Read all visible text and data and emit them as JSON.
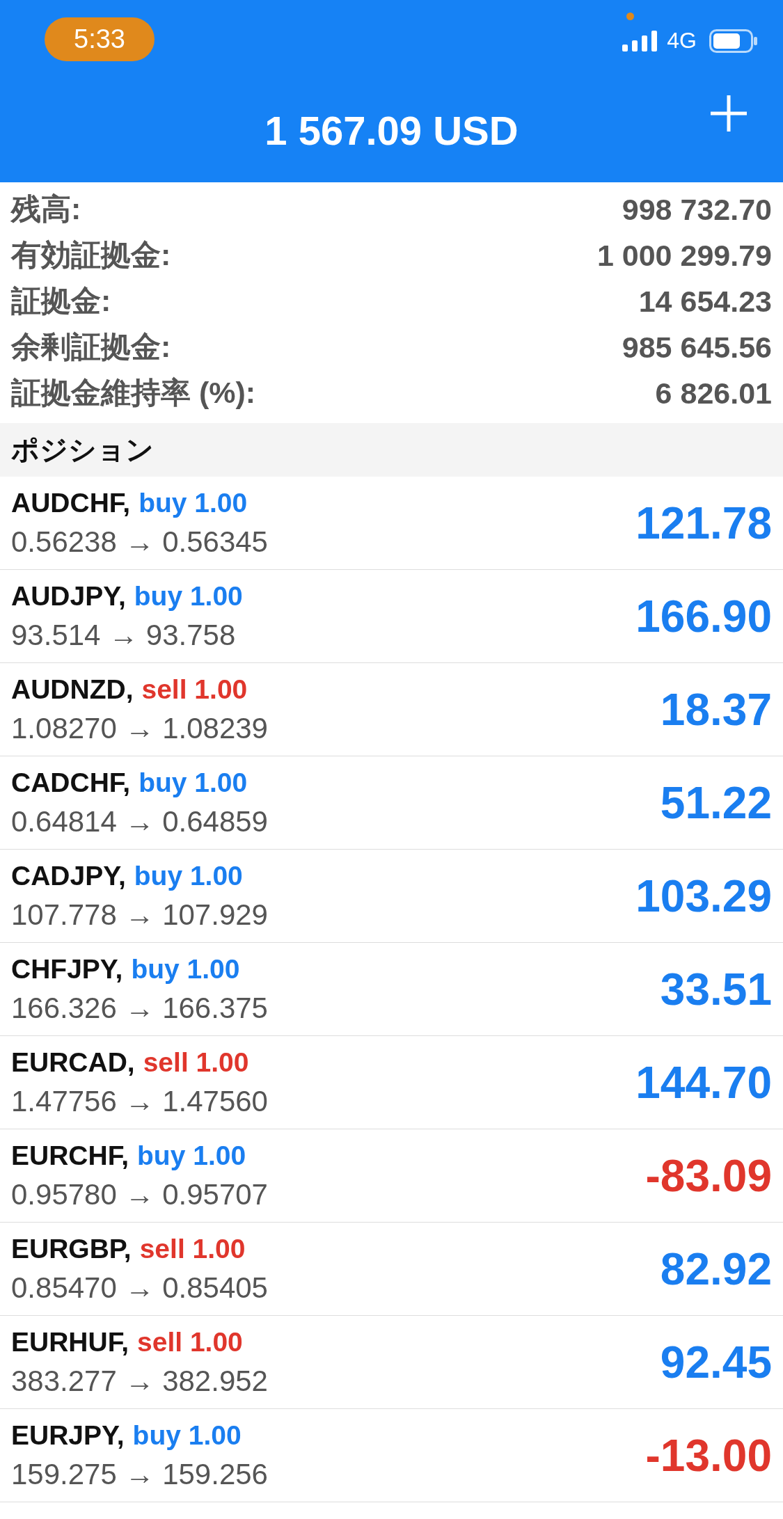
{
  "status_bar": {
    "time": "5:33",
    "network": "4G"
  },
  "header": {
    "title": "1 567.09 USD"
  },
  "summary": [
    {
      "label": "残高:",
      "value": "998 732.70"
    },
    {
      "label": "有効証拠金:",
      "value": "1 000 299.79"
    },
    {
      "label": "証拠金:",
      "value": "14 654.23"
    },
    {
      "label": "余剰証拠金:",
      "value": "985 645.56"
    },
    {
      "label": "証拠金維持率 (%):",
      "value": "6 826.01"
    }
  ],
  "section_title": "ポジション",
  "positions": [
    {
      "symbol": "AUDCHF,",
      "kind": "buy",
      "order": "buy 1.00",
      "prices": "0.56238 → 0.56345",
      "profit": "121.78",
      "loss": false
    },
    {
      "symbol": "AUDJPY,",
      "kind": "buy",
      "order": "buy 1.00",
      "prices": "93.514 → 93.758",
      "profit": "166.90",
      "loss": false
    },
    {
      "symbol": "AUDNZD,",
      "kind": "sell",
      "order": "sell 1.00",
      "prices": "1.08270 → 1.08239",
      "profit": "18.37",
      "loss": false
    },
    {
      "symbol": "CADCHF,",
      "kind": "buy",
      "order": "buy 1.00",
      "prices": "0.64814 → 0.64859",
      "profit": "51.22",
      "loss": false
    },
    {
      "symbol": "CADJPY,",
      "kind": "buy",
      "order": "buy 1.00",
      "prices": "107.778 → 107.929",
      "profit": "103.29",
      "loss": false
    },
    {
      "symbol": "CHFJPY,",
      "kind": "buy",
      "order": "buy 1.00",
      "prices": "166.326 → 166.375",
      "profit": "33.51",
      "loss": false
    },
    {
      "symbol": "EURCAD,",
      "kind": "sell",
      "order": "sell 1.00",
      "prices": "1.47756 → 1.47560",
      "profit": "144.70",
      "loss": false
    },
    {
      "symbol": "EURCHF,",
      "kind": "buy",
      "order": "buy 1.00",
      "prices": "0.95780 → 0.95707",
      "profit": "-83.09",
      "loss": true
    },
    {
      "symbol": "EURGBP,",
      "kind": "sell",
      "order": "sell 1.00",
      "prices": "0.85470 → 0.85405",
      "profit": "82.92",
      "loss": false
    },
    {
      "symbol": "EURHUF,",
      "kind": "sell",
      "order": "sell 1.00",
      "prices": "383.277 → 382.952",
      "profit": "92.45",
      "loss": false
    },
    {
      "symbol": "EURJPY,",
      "kind": "buy",
      "order": "buy 1.00",
      "prices": "159.275 → 159.256",
      "profit": "-13.00",
      "loss": true
    }
  ]
}
